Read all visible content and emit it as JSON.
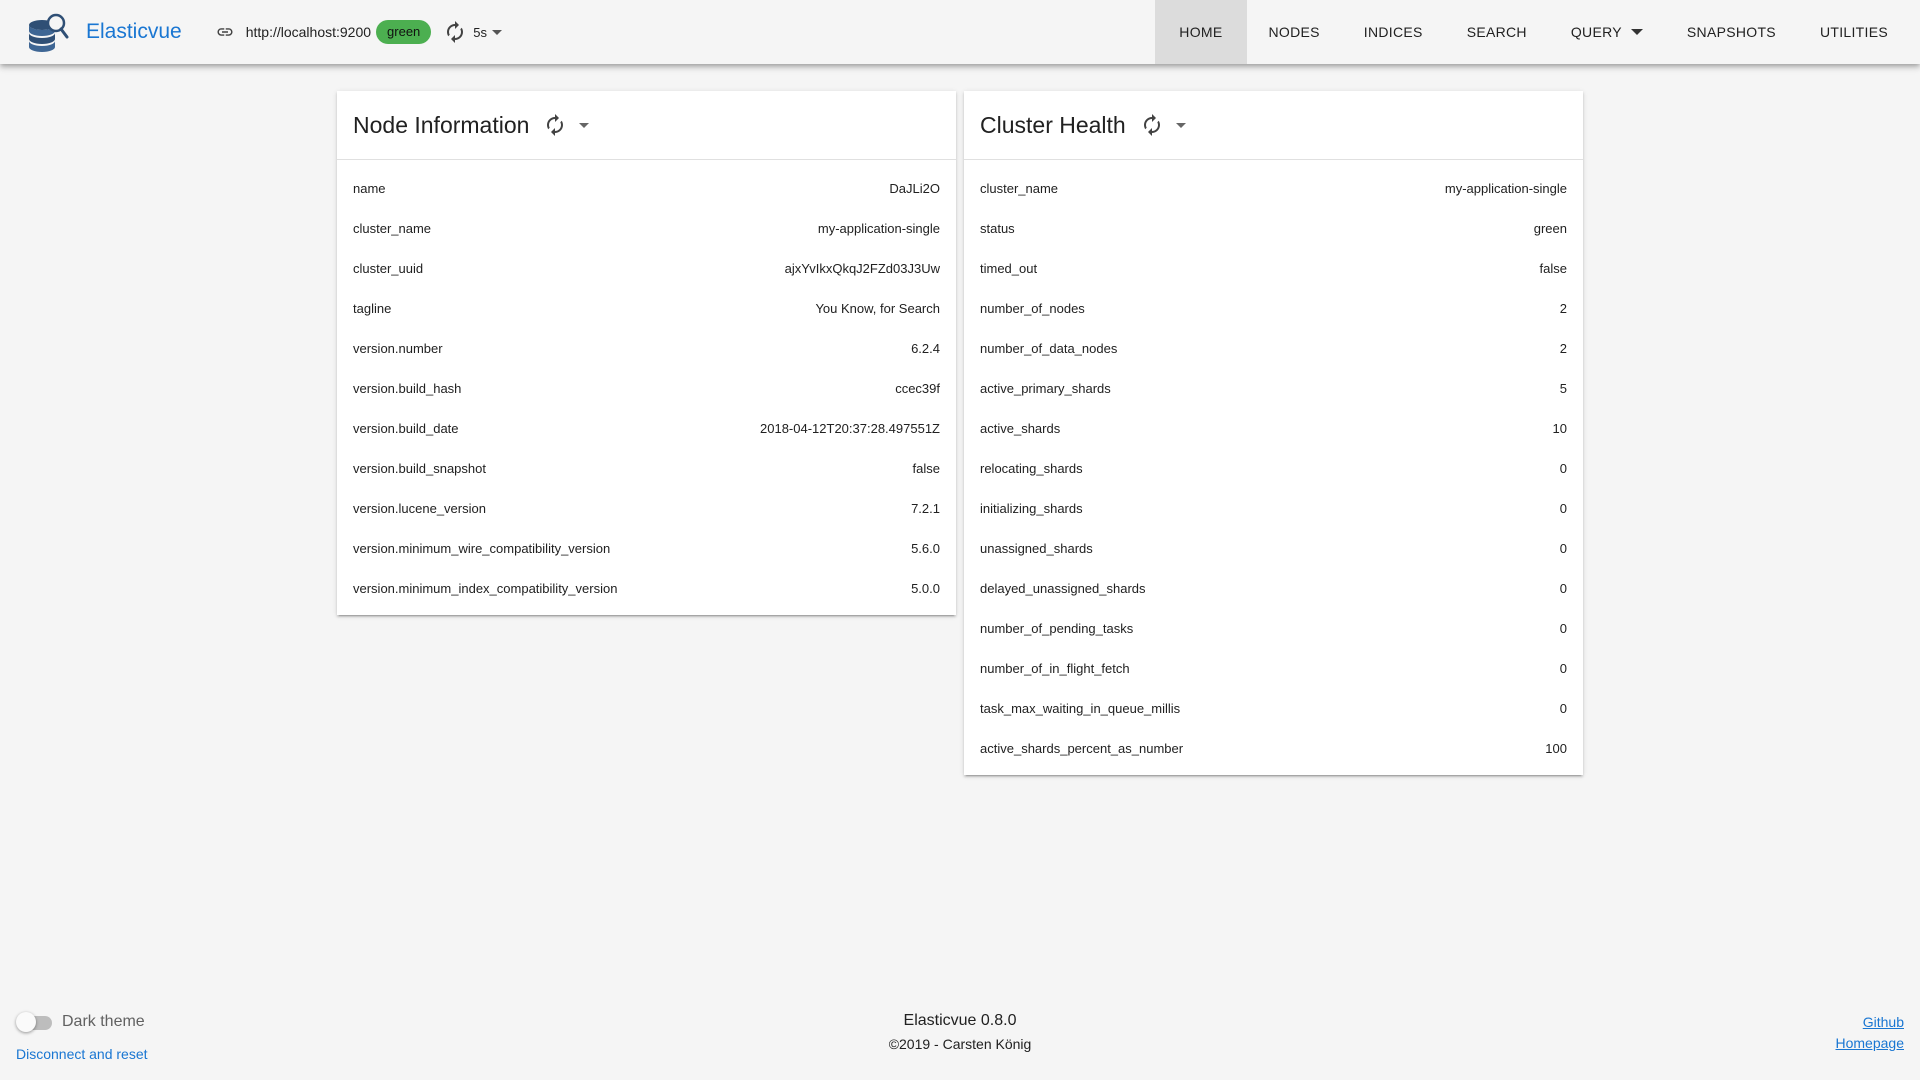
{
  "app": {
    "title": "Elasticvue",
    "logo_icon": "elasticvue-logo-icon"
  },
  "connection": {
    "url": "http://localhost:9200",
    "status": "green",
    "status_color": "#4caf50",
    "refresh_interval": "5s",
    "link_icon": "link-icon",
    "refresh_icon": "refresh-icon"
  },
  "nav": {
    "home": "HOME",
    "nodes": "NODES",
    "indices": "INDICES",
    "search": "SEARCH",
    "query": "QUERY",
    "snapshots": "SNAPSHOTS",
    "utilities": "UTILITIES",
    "active": "HOME"
  },
  "node_info": {
    "title": "Node Information",
    "rows": [
      {
        "key": "name",
        "value": "DaJLi2O"
      },
      {
        "key": "cluster_name",
        "value": "my-application-single"
      },
      {
        "key": "cluster_uuid",
        "value": "ajxYvIkxQkqJ2FZd03J3Uw"
      },
      {
        "key": "tagline",
        "value": "You Know, for Search"
      },
      {
        "key": "version.number",
        "value": "6.2.4"
      },
      {
        "key": "version.build_hash",
        "value": "ccec39f"
      },
      {
        "key": "version.build_date",
        "value": "2018-04-12T20:37:28.497551Z"
      },
      {
        "key": "version.build_snapshot",
        "value": "false"
      },
      {
        "key": "version.lucene_version",
        "value": "7.2.1"
      },
      {
        "key": "version.minimum_wire_compatibility_version",
        "value": "5.6.0"
      },
      {
        "key": "version.minimum_index_compatibility_version",
        "value": "5.0.0"
      }
    ]
  },
  "cluster_health": {
    "title": "Cluster Health",
    "rows": [
      {
        "key": "cluster_name",
        "value": "my-application-single"
      },
      {
        "key": "status",
        "value": "green"
      },
      {
        "key": "timed_out",
        "value": "false"
      },
      {
        "key": "number_of_nodes",
        "value": "2"
      },
      {
        "key": "number_of_data_nodes",
        "value": "2"
      },
      {
        "key": "active_primary_shards",
        "value": "5"
      },
      {
        "key": "active_shards",
        "value": "10"
      },
      {
        "key": "relocating_shards",
        "value": "0"
      },
      {
        "key": "initializing_shards",
        "value": "0"
      },
      {
        "key": "unassigned_shards",
        "value": "0"
      },
      {
        "key": "delayed_unassigned_shards",
        "value": "0"
      },
      {
        "key": "number_of_pending_tasks",
        "value": "0"
      },
      {
        "key": "number_of_in_flight_fetch",
        "value": "0"
      },
      {
        "key": "task_max_waiting_in_queue_millis",
        "value": "0"
      },
      {
        "key": "active_shards_percent_as_number",
        "value": "100"
      }
    ]
  },
  "footer": {
    "dark_theme_label": "Dark theme",
    "dark_theme_enabled": false,
    "disconnect_label": "Disconnect and reset",
    "version": "Elasticvue 0.8.0",
    "copyright": "©2019 - Carsten König",
    "github_label": "Github",
    "homepage_label": "Homepage"
  },
  "colors": {
    "accent": "#1976d2",
    "status_green": "#4caf50"
  }
}
